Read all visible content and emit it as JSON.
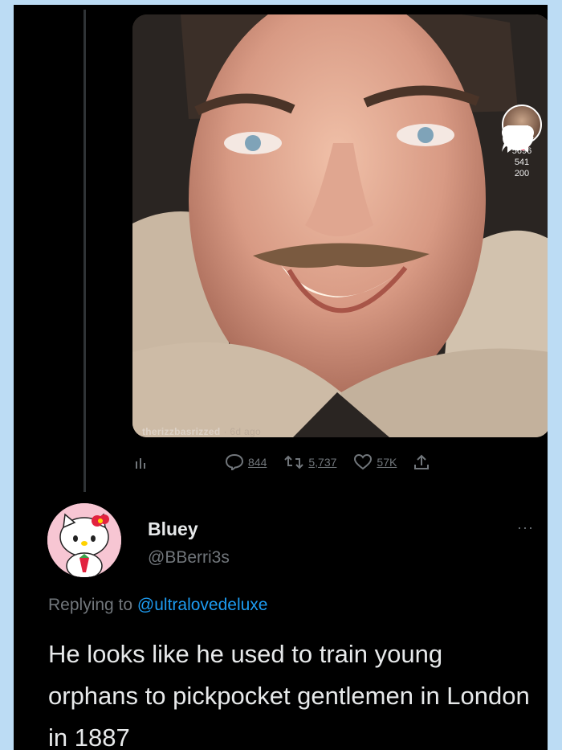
{
  "media": {
    "watermark_user": "therizzbasrizzed",
    "watermark_date": "· 6d ago",
    "side_actions": {
      "like_count": "5696",
      "bookmark_count": "541",
      "share_count": "200"
    }
  },
  "tweet_actions": {
    "replies": "844",
    "retweets": "5,737",
    "likes": "57K"
  },
  "reply": {
    "display_name": "Bluey",
    "handle": "@BBerri3s",
    "replying_prefix": "Replying to",
    "replying_to": "@ultralovedeluxe",
    "text": "He looks like he used to train young orphans to pickpocket gentlemen in London in 1887",
    "more": "···"
  },
  "colors": {
    "background": "#000000",
    "page_border": "#bcdcf4",
    "link": "#1d9bf0",
    "muted": "#71767b",
    "text": "#e7e9ea",
    "tiktok_red": "#fe2c55"
  }
}
